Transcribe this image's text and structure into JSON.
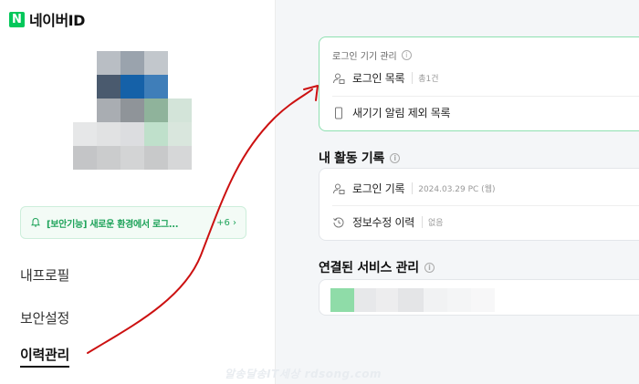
{
  "logo": {
    "mark": "N",
    "text": "네이버ID"
  },
  "notice": {
    "text": "[보안기능] 새로운 환경에서 로그...",
    "count": "+6 ›"
  },
  "menu": [
    {
      "label": "내프로필",
      "active": false
    },
    {
      "label": "보안설정",
      "active": false
    },
    {
      "label": "이력관리",
      "active": true
    }
  ],
  "login_devices": {
    "title": "로그인 기기 관리",
    "info": "i",
    "rows": [
      {
        "label": "로그인 목록",
        "sub": "총1건",
        "icon": "user-lock-icon"
      },
      {
        "label": "새기기 알림 제외 목록",
        "sub": "",
        "icon": "phone-icon"
      }
    ]
  },
  "activity": {
    "title": "내 활동 기록",
    "info": "i",
    "rows": [
      {
        "label": "로그인 기록",
        "sub": "2024.03.29 PC (웹)",
        "icon": "user-lock-icon"
      },
      {
        "label": "정보수정 이력",
        "sub": "없음",
        "icon": "history-icon"
      }
    ]
  },
  "services": {
    "title": "연결된 서비스 관리",
    "info": "i"
  },
  "watermark": "알송달송IT세상 rdsong.com",
  "colors": {
    "brand": "#03c75a",
    "annotation": "#cc1111"
  }
}
